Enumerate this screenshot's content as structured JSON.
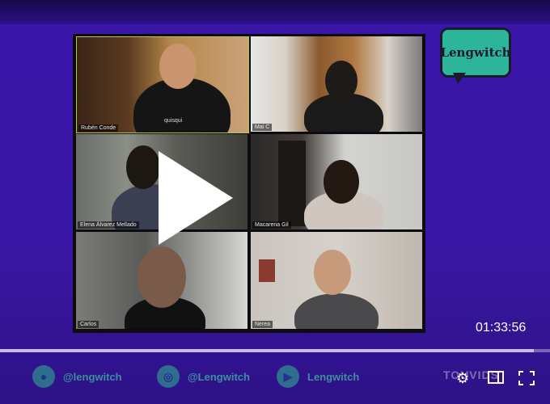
{
  "player": {
    "time": "01:33:56",
    "progress_fraction": 0.97
  },
  "brand": {
    "logo_text": "Lengwitch"
  },
  "participants": [
    {
      "name": "Rubén Conde"
    },
    {
      "name": "Mai C"
    },
    {
      "name": "Elena Álvarez Mellado"
    },
    {
      "name": "Macarena Gil"
    },
    {
      "name": "Carlos"
    },
    {
      "name": "Nerea"
    }
  ],
  "shirt_text": "quisqui",
  "social": {
    "twitter_handle": "@lengwitch",
    "instagram_handle": "@Lengwitch",
    "youtube_name": "Lengwitch"
  },
  "watermark": "TOUVIDS",
  "colors": {
    "background": "#3a16a8",
    "logo": "#2db59a",
    "active_speaker_border": "#b9c64a"
  },
  "icons": [
    "play-icon",
    "twitter-icon",
    "instagram-icon",
    "youtube-icon",
    "settings-icon",
    "theater-icon",
    "fullscreen-icon"
  ]
}
